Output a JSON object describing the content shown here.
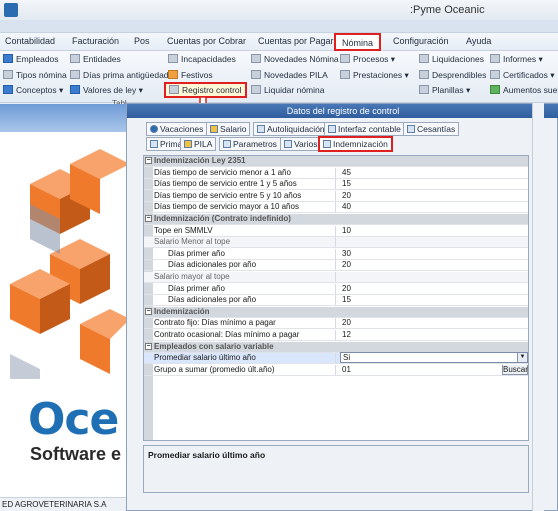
{
  "app": {
    "title": ":Pyme Oceanic"
  },
  "menu": [
    {
      "label": "Contabilidad"
    },
    {
      "label": "Facturación"
    },
    {
      "label": "Pos"
    },
    {
      "label": "Cuentas por Cobrar"
    },
    {
      "label": "Cuentas por Pagar"
    },
    {
      "label": "Nómina"
    },
    {
      "label": "Configuración"
    },
    {
      "label": "Ayuda"
    }
  ],
  "ribbon": {
    "empleados": "Empleados",
    "tipos_nomina": "Tipos nómina",
    "conceptos": "Conceptos",
    "entidades": "Entidades",
    "dias_prima": "Días prima antigüedad",
    "valores_ley": "Valores de ley",
    "incapacidades": "Incapacidades",
    "festivos": "Festivos",
    "registro_control": "Registro control",
    "novedades_nomina": "Novedades Nómina",
    "novedades_pila": "Novedades PILA",
    "liquidar_nomina": "Liquidar nómina",
    "procesos": "Procesos",
    "prestaciones": "Prestaciones",
    "liquidaciones": "Liquidaciones",
    "desprendibles": "Desprendibles",
    "planillas": "Planillas",
    "informes": "Informes",
    "certificados": "Certificados",
    "aumentos": "Aumentos suel",
    "group_label": "Tabl"
  },
  "left": {
    "brand": "Oce",
    "software": "Software e",
    "company": "ED AGROVETERINARIA S.A"
  },
  "dialog": {
    "title": "Datos del registro de control",
    "tabs_row1": [
      "Vacaciones",
      "Salario",
      "Autoliquidación",
      "Interfaz contable",
      "Cesantías"
    ],
    "tabs_row2": [
      "Prima",
      "PILA",
      "Parametros",
      "Varios",
      "Indemnización"
    ],
    "grid": [
      {
        "type": "cat",
        "label": "Indemnización Ley 2351"
      },
      {
        "type": "row",
        "label": "Días tiempo de servicio menor a 1 año",
        "value": "45"
      },
      {
        "type": "row",
        "label": "Días tiempo de servicio entre 1 y 5 años",
        "value": "15"
      },
      {
        "type": "row",
        "label": "Días tiempo de servicio entre 5 y 10 años",
        "value": "20"
      },
      {
        "type": "row",
        "label": "Días tiempo de servicio mayor a 10 años",
        "value": "40"
      },
      {
        "type": "cat",
        "label": "Indemnización (Contrato indefinido)"
      },
      {
        "type": "row",
        "label": "Tope en SMMLV",
        "value": "10"
      },
      {
        "type": "sub",
        "label": "Salario Menor al tope"
      },
      {
        "type": "indent",
        "label": "Días primer año",
        "value": "30"
      },
      {
        "type": "indent",
        "label": "Días adicionales por año",
        "value": "20"
      },
      {
        "type": "sub",
        "label": "Salario mayor al tope"
      },
      {
        "type": "indent",
        "label": "Días primer año",
        "value": "20"
      },
      {
        "type": "indent",
        "label": "Días adicionales por año",
        "value": "15"
      },
      {
        "type": "cat",
        "label": "Indemnización"
      },
      {
        "type": "row",
        "label": "Contrato fijo: Días mínimo a pagar",
        "value": "20"
      },
      {
        "type": "row",
        "label": "Contrato ocasional: Días mínimo a pagar",
        "value": "12"
      },
      {
        "type": "cat",
        "label": "Empleados con salario variable"
      },
      {
        "type": "selrow",
        "label": "Promediar salario último año",
        "value": "Si"
      },
      {
        "type": "btnrow",
        "label": "Grupo a sumar (promedio últ.año)",
        "value": "01",
        "button": "Buscar"
      }
    ],
    "description": "Promediar salario último año"
  },
  "colors": {
    "accent": "#e02020",
    "brand_blue": "#1f6fb5",
    "title_bar": "#2f5d9e"
  }
}
